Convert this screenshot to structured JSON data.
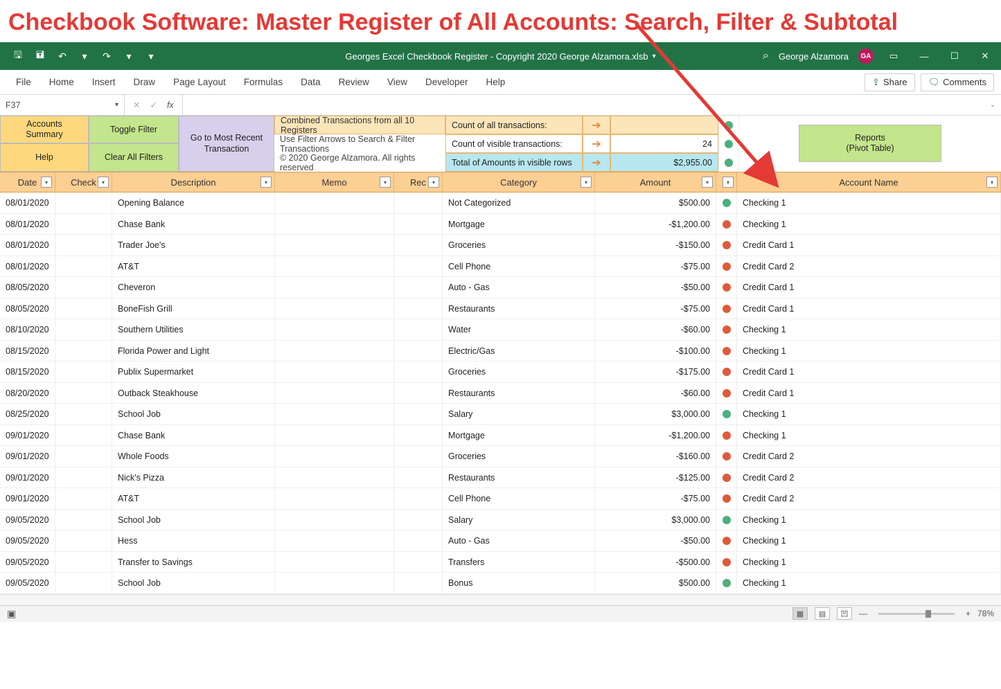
{
  "headline": "Checkbook Software: Master Register of All Accounts: Search, Filter & Subtotal",
  "titlebar": {
    "filename": "Georges Excel Checkbook Register - Copyright 2020 George Alzamora.xlsb",
    "user": "George Alzamora",
    "initials": "GA"
  },
  "ribbon": {
    "tabs": [
      "File",
      "Home",
      "Insert",
      "Draw",
      "Page Layout",
      "Formulas",
      "Data",
      "Review",
      "View",
      "Developer",
      "Help"
    ],
    "share": "Share",
    "comments": "Comments"
  },
  "formulabar": {
    "namebox": "F37",
    "fx": "fx",
    "formula": ""
  },
  "buttons": {
    "accounts_summary": "Accounts\nSummary",
    "toggle_filter": "Toggle Filter",
    "goto_recent": "Go to Most Recent\nTransaction",
    "help": "Help",
    "clear_filters": "Clear All Filters",
    "reports": "Reports\n(Pivot Table)"
  },
  "notes": {
    "line1": "Combined Transactions from all 10 Registers",
    "line2": "Use Filter Arrows to Search & Filter Transactions",
    "copyright": "© 2020 George Alzamora. All rights reserved"
  },
  "stats": {
    "count_all_label": "Count of all transactions:",
    "count_visible_label": "Count of visible transactions:",
    "count_visible_value": "24",
    "total_label": "Total of Amounts in visible rows",
    "total_value": "$2,955.00"
  },
  "columns": {
    "date": "Date",
    "check": "Check",
    "description": "Description",
    "memo": "Memo",
    "rec": "Rec",
    "category": "Category",
    "amount": "Amount",
    "status": "+",
    "account": "Account Name"
  },
  "rows": [
    {
      "date": "08/01/2020",
      "desc": "Opening Balance",
      "cat": "Not Categorized",
      "amt": "$500.00",
      "pos": true,
      "acct": "Checking 1"
    },
    {
      "date": "08/01/2020",
      "desc": "Chase Bank",
      "cat": "Mortgage",
      "amt": "-$1,200.00",
      "pos": false,
      "acct": "Checking 1"
    },
    {
      "date": "08/01/2020",
      "desc": "Trader Joe's",
      "cat": "Groceries",
      "amt": "-$150.00",
      "pos": false,
      "acct": "Credit Card 1"
    },
    {
      "date": "08/01/2020",
      "desc": "AT&T",
      "cat": "Cell Phone",
      "amt": "-$75.00",
      "pos": false,
      "acct": "Credit Card 2"
    },
    {
      "date": "08/05/2020",
      "desc": "Cheveron",
      "cat": "Auto - Gas",
      "amt": "-$50.00",
      "pos": false,
      "acct": "Credit Card 1"
    },
    {
      "date": "08/05/2020",
      "desc": "BoneFish Grill",
      "cat": "Restaurants",
      "amt": "-$75.00",
      "pos": false,
      "acct": "Credit Card 1"
    },
    {
      "date": "08/10/2020",
      "desc": "Southern Utilities",
      "cat": "Water",
      "amt": "-$60.00",
      "pos": false,
      "acct": "Checking 1"
    },
    {
      "date": "08/15/2020",
      "desc": "Florida Power and Light",
      "cat": "Electric/Gas",
      "amt": "-$100.00",
      "pos": false,
      "acct": "Checking 1"
    },
    {
      "date": "08/15/2020",
      "desc": "Publix Supermarket",
      "cat": "Groceries",
      "amt": "-$175.00",
      "pos": false,
      "acct": "Credit Card 1"
    },
    {
      "date": "08/20/2020",
      "desc": "Outback Steakhouse",
      "cat": "Restaurants",
      "amt": "-$60.00",
      "pos": false,
      "acct": "Credit Card 1"
    },
    {
      "date": "08/25/2020",
      "desc": "School Job",
      "cat": "Salary",
      "amt": "$3,000.00",
      "pos": true,
      "acct": "Checking 1"
    },
    {
      "date": "09/01/2020",
      "desc": "Chase Bank",
      "cat": "Mortgage",
      "amt": "-$1,200.00",
      "pos": false,
      "acct": "Checking 1"
    },
    {
      "date": "09/01/2020",
      "desc": "Whole Foods",
      "cat": "Groceries",
      "amt": "-$160.00",
      "pos": false,
      "acct": "Credit Card 2"
    },
    {
      "date": "09/01/2020",
      "desc": "Nick's Pizza",
      "cat": "Restaurants",
      "amt": "-$125.00",
      "pos": false,
      "acct": "Credit Card 2"
    },
    {
      "date": "09/01/2020",
      "desc": "AT&T",
      "cat": "Cell Phone",
      "amt": "-$75.00",
      "pos": false,
      "acct": "Credit Card 2"
    },
    {
      "date": "09/05/2020",
      "desc": "School Job",
      "cat": "Salary",
      "amt": "$3,000.00",
      "pos": true,
      "acct": "Checking 1"
    },
    {
      "date": "09/05/2020",
      "desc": "Hess",
      "cat": "Auto - Gas",
      "amt": "-$50.00",
      "pos": false,
      "acct": "Checking 1"
    },
    {
      "date": "09/05/2020",
      "desc": "Transfer to Savings",
      "cat": "Transfers",
      "amt": "-$500.00",
      "pos": false,
      "acct": "Checking 1"
    },
    {
      "date": "09/05/2020",
      "desc": "School Job",
      "cat": "Bonus",
      "amt": "$500.00",
      "pos": true,
      "acct": "Checking 1"
    }
  ],
  "statusbar": {
    "zoom": "78%"
  }
}
